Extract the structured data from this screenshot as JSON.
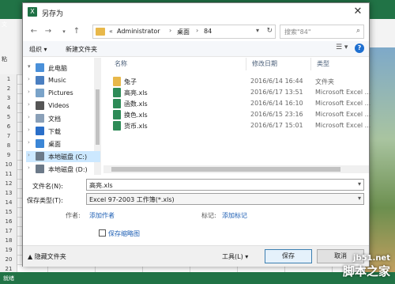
{
  "background": {
    "ribbon_tab": "文",
    "paste_label": "粘",
    "clipboard_label": "剪",
    "row_numbers": [
      "1",
      "2",
      "3",
      "4",
      "5",
      "6",
      "7",
      "8",
      "9",
      "10",
      "11",
      "12",
      "13",
      "14",
      "15",
      "16",
      "17",
      "18",
      "19",
      "20",
      "21"
    ],
    "status_text": "就绪"
  },
  "dialog": {
    "title": "另存为",
    "close_glyph": "✕"
  },
  "nav": {
    "back": "←",
    "forward": "→",
    "up": "↑",
    "breadcrumb_prefix": "«",
    "path": [
      "Administrator",
      "桌面",
      "84"
    ],
    "search_placeholder": "搜索\"84\""
  },
  "toolbar": {
    "organize": "组织 ▾",
    "new_folder": "新建文件夹",
    "view_glyph": "☰ ▾",
    "help_glyph": "?"
  },
  "nav_pane": {
    "items": [
      {
        "label": "此电脑",
        "icon": "computer-icon",
        "color": "#4a90d9"
      },
      {
        "label": "Music",
        "icon": "music-icon",
        "color": "#4a7fc1"
      },
      {
        "label": "Pictures",
        "icon": "pictures-icon",
        "color": "#7aa3c9"
      },
      {
        "label": "Videos",
        "icon": "videos-icon",
        "color": "#555555"
      },
      {
        "label": "文档",
        "icon": "documents-icon",
        "color": "#8aa0b8"
      },
      {
        "label": "下载",
        "icon": "downloads-icon",
        "color": "#2a6fc9"
      },
      {
        "label": "桌面",
        "icon": "desktop-icon",
        "color": "#3b86d6"
      },
      {
        "label": "本地磁盘 (C:)",
        "icon": "drive-c-icon",
        "color": "#6c7a89"
      },
      {
        "label": "本地磁盘 (D:)",
        "icon": "drive-d-icon",
        "color": "#6c7a89"
      }
    ]
  },
  "file_list": {
    "columns": [
      "名称",
      "修改日期",
      "类型"
    ],
    "files": [
      {
        "name": "兔子",
        "date": "2016/6/14 16:44",
        "type": "文件夹",
        "icon": "folder-icon",
        "color": "#e8b84a"
      },
      {
        "name": "高亮.xls",
        "date": "2016/6/17 13:51",
        "type": "Microsoft Excel ...",
        "icon": "excel-file-icon",
        "color": "#2e8b57"
      },
      {
        "name": "函数.xls",
        "date": "2016/6/14 16:10",
        "type": "Microsoft Excel ...",
        "icon": "excel-file-icon",
        "color": "#2e8b57"
      },
      {
        "name": "换色.xls",
        "date": "2016/6/15 23:16",
        "type": "Microsoft Excel ...",
        "icon": "excel-file-icon",
        "color": "#2e8b57"
      },
      {
        "name": "货币.xls",
        "date": "2016/6/17 15:01",
        "type": "Microsoft Excel ...",
        "icon": "excel-file-icon",
        "color": "#2e8b57"
      }
    ]
  },
  "form": {
    "filename_label": "文件名(N):",
    "filename_value": "高亮.xls",
    "savetype_label": "保存类型(T):",
    "savetype_value": "Excel 97-2003 工作簿(*.xls)",
    "author_label": "作者:",
    "author_link": "添加作者",
    "tag_label": "标记:",
    "tag_link": "添加标记",
    "thumbnail_label": "保存缩略图"
  },
  "footer": {
    "hide_folders": "▲ 隐藏文件夹",
    "tools": "工具(L) ▾",
    "save": "保存",
    "cancel": "取消"
  },
  "watermark": {
    "line1": "jb51.net",
    "line2": "脚本之家"
  }
}
